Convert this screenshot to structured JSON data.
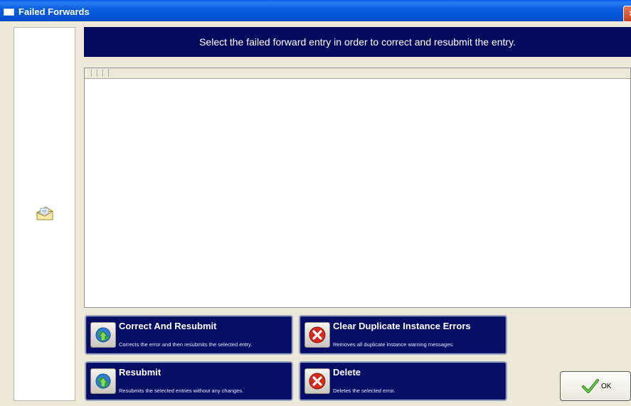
{
  "window": {
    "title": "Failed Forwards",
    "close_label": "×"
  },
  "banner": {
    "text": "Select the failed forward entry in order to correct and resubmit the entry."
  },
  "actions": [
    {
      "label": "Correct And Resubmit",
      "description": "Corrects the error and then resubmits the selected entry.",
      "icon": "globe-arrow-icon"
    },
    {
      "label": "Clear Duplicate Instance Errors",
      "description": "Removes all duplicate instance warning messages.",
      "icon": "red-x-icon"
    },
    {
      "label": "Resubmit",
      "description": "Resubmits the selected entries without any changes.",
      "icon": "globe-arrow-icon"
    },
    {
      "label": "Delete",
      "description": "Deletes the selected error.",
      "icon": "red-x-icon"
    }
  ],
  "ok_button": {
    "label": "OK"
  },
  "colors": {
    "banner": "#050a5e",
    "button_bg": "#060d64",
    "titlebar": "#0553d6",
    "window_bg": "#ece9d8"
  }
}
